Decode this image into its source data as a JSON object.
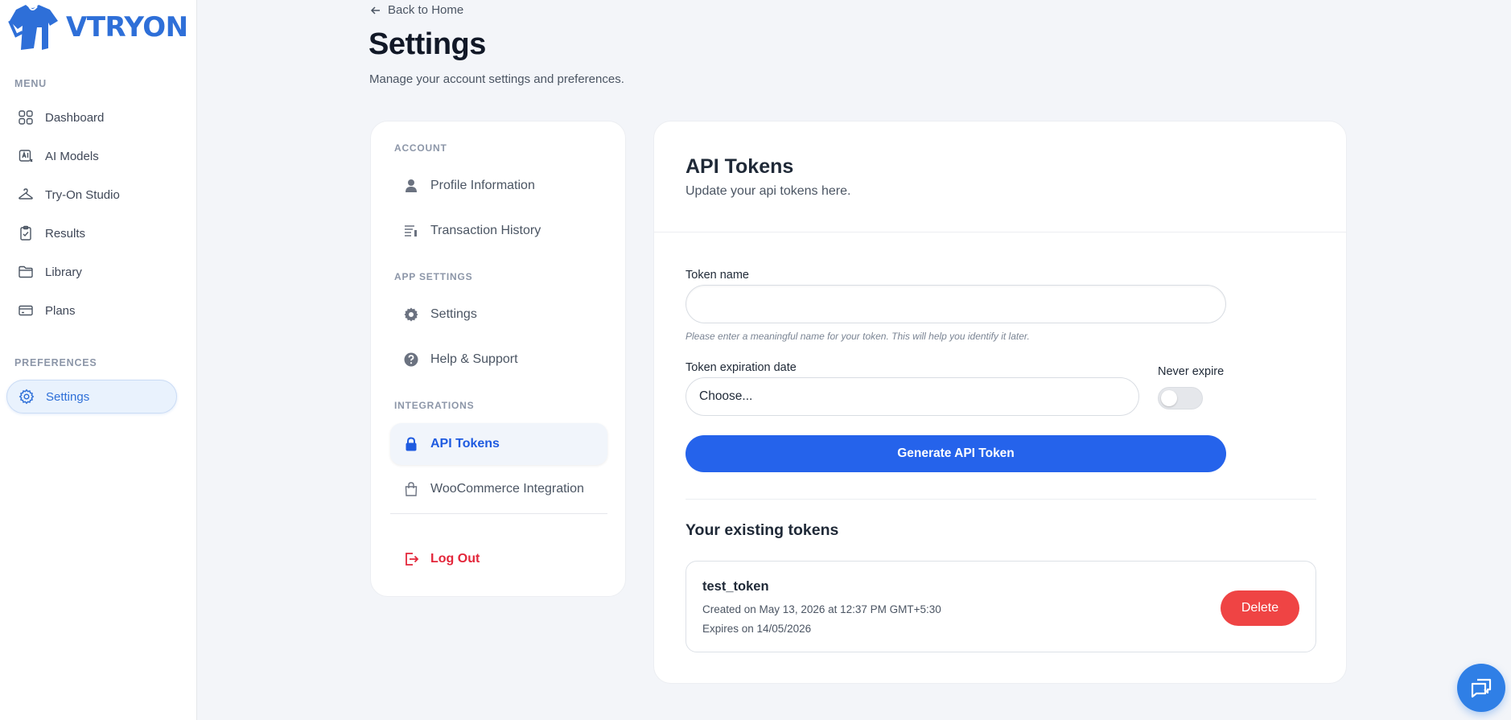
{
  "brand": {
    "name": "VTRYON",
    "color": "#2e6fd8"
  },
  "sidebar": {
    "menu_heading": "MENU",
    "items": [
      {
        "label": "Dashboard",
        "icon": "grid-icon"
      },
      {
        "label": "AI Models",
        "icon": "ai-model-icon"
      },
      {
        "label": "Try-On Studio",
        "icon": "hanger-icon"
      },
      {
        "label": "Results",
        "icon": "clipboard-check-icon"
      },
      {
        "label": "Library",
        "icon": "folder-icon"
      },
      {
        "label": "Plans",
        "icon": "credit-card-icon"
      }
    ],
    "preferences_heading": "PREFERENCES",
    "settings_label": "Settings"
  },
  "header": {
    "back_label": "Back to Home",
    "title": "Settings",
    "subtitle": "Manage your account settings and preferences."
  },
  "settings_nav": {
    "account_heading": "ACCOUNT",
    "profile_label": "Profile Information",
    "transactions_label": "Transaction History",
    "app_settings_heading": "APP SETTINGS",
    "settings_label": "Settings",
    "help_label": "Help & Support",
    "integrations_heading": "INTEGRATIONS",
    "api_tokens_label": "API Tokens",
    "woocommerce_label": "WooCommerce Integration",
    "logout_label": "Log Out"
  },
  "main": {
    "title": "API Tokens",
    "subtitle": "Update your api tokens here.",
    "token_name_label": "Token name",
    "token_name_value": "",
    "token_name_hint": "Please enter a meaningful name for your token. This will help you identify it later.",
    "expiration_label": "Token expiration date",
    "expiration_value": "Choose...",
    "never_expire_label": "Never expire",
    "never_expire_on": false,
    "generate_label": "Generate API Token",
    "existing_heading": "Your existing tokens",
    "tokens": [
      {
        "name": "test_token",
        "created": "Created on May 13, 2026 at 12:37 PM GMT+5:30",
        "expires": "Expires on 14/05/2026",
        "delete_label": "Delete"
      }
    ]
  },
  "colors": {
    "primary": "#2563eb",
    "danger": "#ef4444",
    "logout": "#e3263a"
  }
}
